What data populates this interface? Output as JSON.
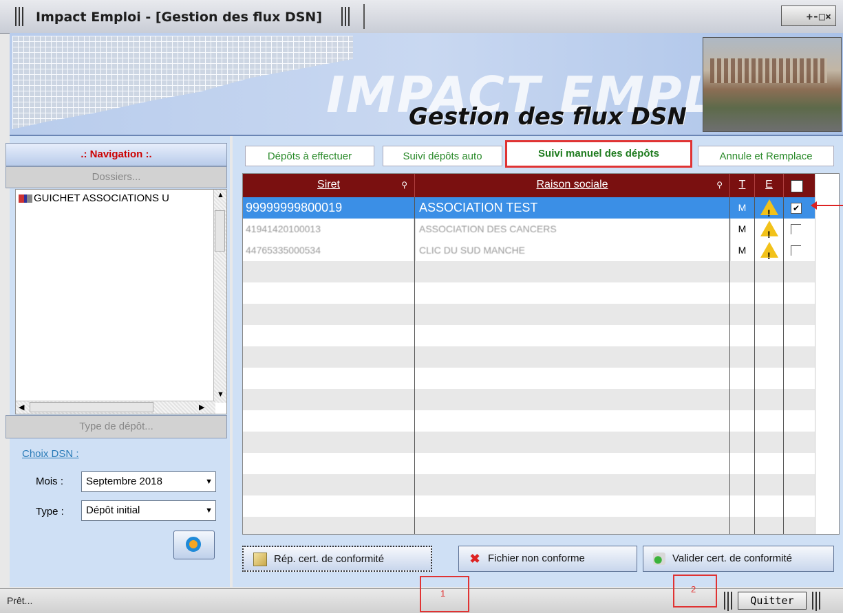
{
  "window": {
    "title": "Impact Emploi - [Gestion des flux DSN]",
    "controls": "+-□×"
  },
  "banner": {
    "brand": "IMPACT EMPLOI",
    "subtitle": "Gestion des flux DSN"
  },
  "navigation": {
    "header": ".: Navigation :.",
    "dossiers_header": "Dossiers...",
    "tree_items": [
      "GUICHET ASSOCIATIONS U"
    ],
    "type_depot_header": "Type de dépôt...",
    "choix_dsn": "Choix DSN :",
    "mois_label": "Mois :",
    "mois_value": "Septembre 2018",
    "type_label": "Type :",
    "type_value": "Dépôt initial"
  },
  "tabs": [
    {
      "label": "Dépôts à effectuer"
    },
    {
      "label": "Suivi dépôts auto"
    },
    {
      "label": "Suivi manuel des dépôts",
      "active": true
    },
    {
      "label": "Annule et Remplace"
    }
  ],
  "grid": {
    "columns": [
      "Siret",
      "Raison sociale",
      "T",
      "E"
    ],
    "rows": [
      {
        "siret": "99999999800019",
        "raison": "ASSOCIATION TEST",
        "t": "M",
        "checked": true
      },
      {
        "siret": "41941420100013",
        "raison": "ASSOCIATION DES CANCERS",
        "t": "M",
        "checked": false
      },
      {
        "siret": "44765335000534",
        "raison": "CLIC DU SUD MANCHE",
        "t": "M",
        "checked": false
      }
    ]
  },
  "buttons": {
    "rep_cert": "Rép. cert. de conformité",
    "fichier_non_conforme": "Fichier non conforme",
    "valider_cert": "Valider cert. de conformité"
  },
  "status": {
    "text": "Prêt...",
    "quit": "Quitter"
  },
  "annotations": [
    "1",
    "2"
  ],
  "colors": {
    "grid_header": "#7a1010",
    "selected_row": "#3b8fe6",
    "tab_text": "#2a8a2a",
    "annotation_red": "#e03333"
  }
}
